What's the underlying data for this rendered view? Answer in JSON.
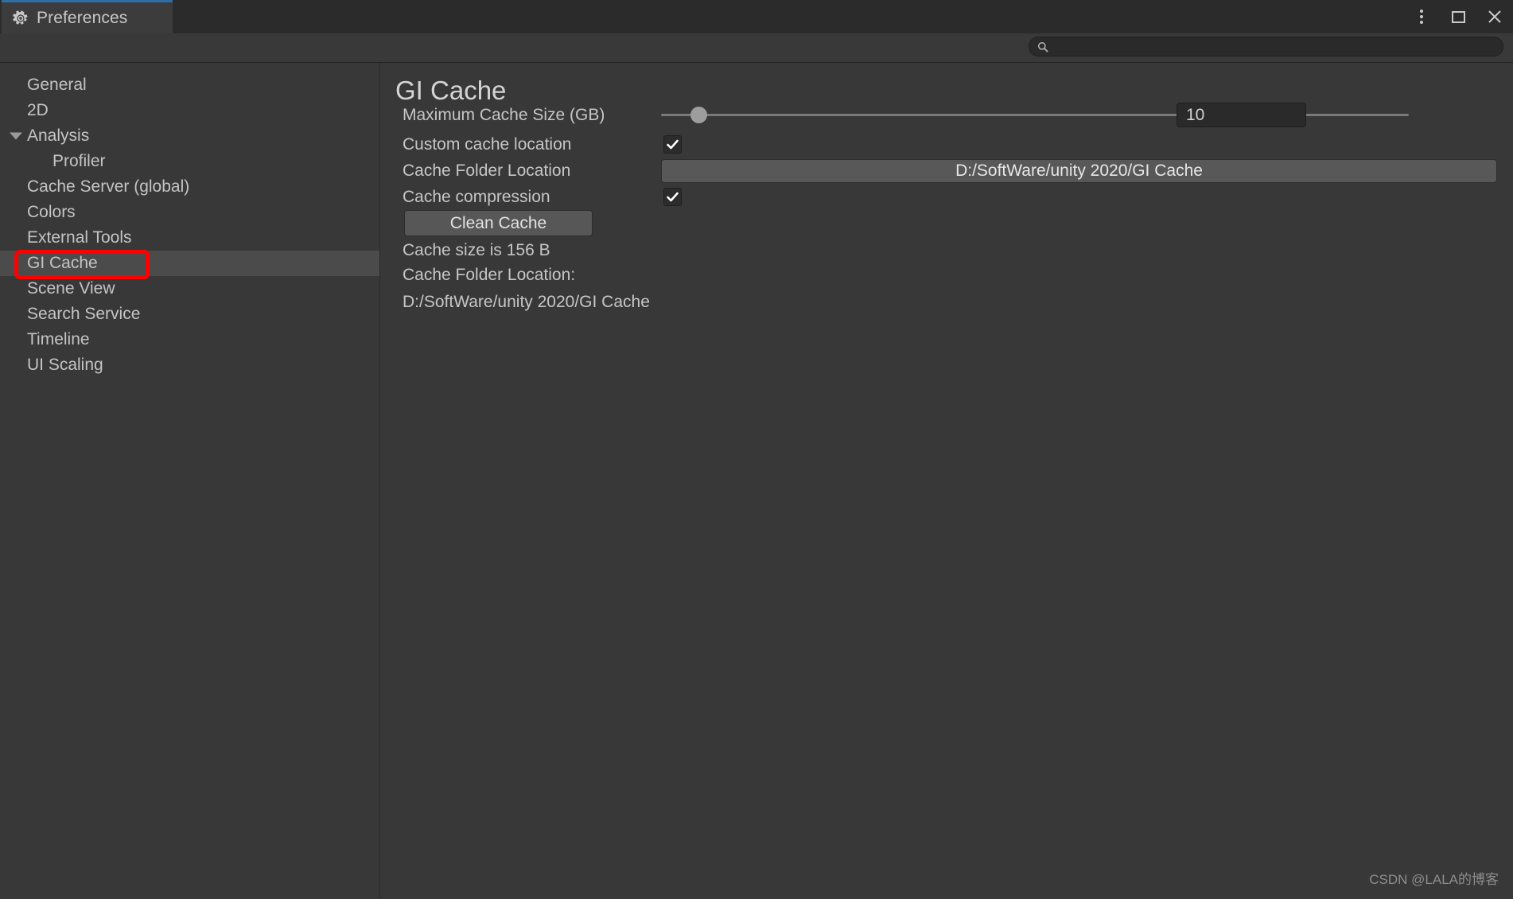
{
  "window": {
    "tab_title": "Preferences",
    "tab_icon": "gear-icon",
    "controls": {
      "menu": "more-options-icon",
      "maximize": "maximize-icon",
      "close": "close-icon"
    },
    "accent_color": "#2c6ea5"
  },
  "search": {
    "icon": "search-icon",
    "value": "",
    "placeholder": ""
  },
  "sidebar": {
    "items": [
      {
        "label": "General",
        "indent": false,
        "expandable": false,
        "selected": false
      },
      {
        "label": "2D",
        "indent": false,
        "expandable": false,
        "selected": false
      },
      {
        "label": "Analysis",
        "indent": false,
        "expandable": true,
        "expanded": true,
        "selected": false
      },
      {
        "label": "Profiler",
        "indent": true,
        "expandable": false,
        "selected": false
      },
      {
        "label": "Cache Server (global)",
        "indent": false,
        "expandable": false,
        "selected": false
      },
      {
        "label": "Colors",
        "indent": false,
        "expandable": false,
        "selected": false
      },
      {
        "label": "External Tools",
        "indent": false,
        "expandable": false,
        "selected": false
      },
      {
        "label": "GI Cache",
        "indent": false,
        "expandable": false,
        "selected": true
      },
      {
        "label": "Scene View",
        "indent": false,
        "expandable": false,
        "selected": false
      },
      {
        "label": "Search Service",
        "indent": false,
        "expandable": false,
        "selected": false
      },
      {
        "label": "Timeline",
        "indent": false,
        "expandable": false,
        "selected": false
      },
      {
        "label": "UI Scaling",
        "indent": false,
        "expandable": false,
        "selected": false
      }
    ],
    "annotation_color": "#ff0000",
    "annotated_item": "GI Cache"
  },
  "main": {
    "title": "GI Cache",
    "max_cache_size": {
      "label": "Maximum Cache Size (GB)",
      "value": "10",
      "slider_min": "0",
      "slider_max": "200",
      "slider_position_percent": 5
    },
    "custom_cache_location": {
      "label": "Custom cache location",
      "checked": true
    },
    "cache_folder_location": {
      "label": "Cache Folder Location",
      "value": "D:/SoftWare/unity 2020/GI Cache"
    },
    "cache_compression": {
      "label": "Cache compression",
      "checked": true
    },
    "clean_cache_button": "Clean Cache",
    "cache_size_text": "Cache size is 156 B",
    "cache_folder_location_caption": "Cache Folder Location:",
    "cache_folder_location_path": "D:/SoftWare/unity 2020/GI Cache"
  },
  "watermark": "CSDN @LALA的博客"
}
